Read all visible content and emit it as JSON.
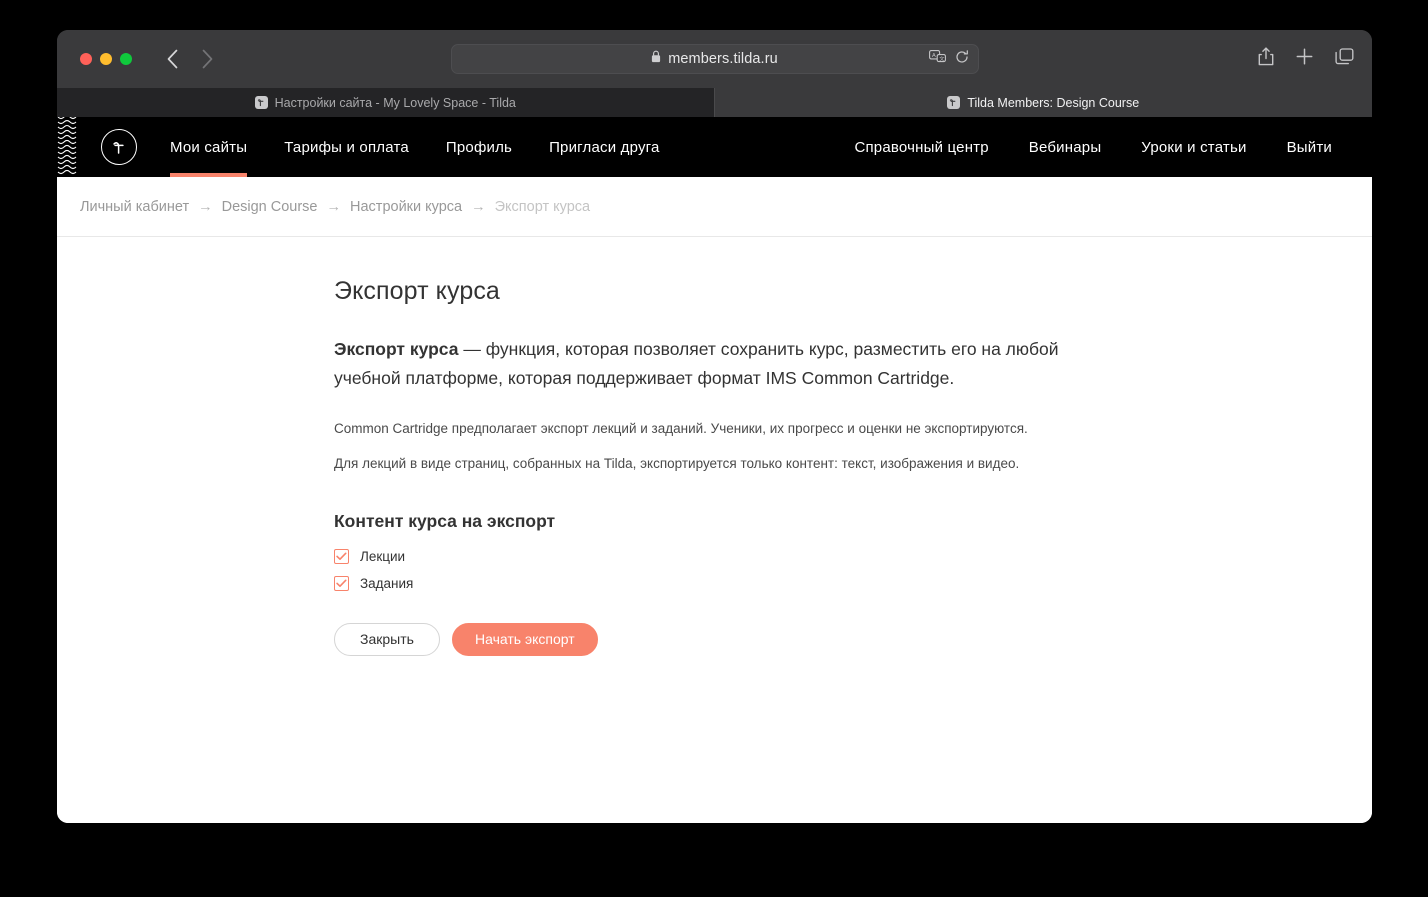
{
  "browser": {
    "url": "members.tilda.ru",
    "lock_icon": "lock-icon",
    "back_icon": "back-arrow-icon",
    "forward_icon": "forward-arrow-icon",
    "translate_icon": "translate-icon",
    "reload_icon": "reload-icon",
    "share_icon": "share-icon",
    "newtab_icon": "plus-icon",
    "taboverview_icon": "tab-overview-icon",
    "traffic": {
      "close": "close-window-button",
      "minimize": "minimize-window-button",
      "zoom": "zoom-window-button"
    },
    "tabs": [
      {
        "title": "Настройки сайта - My Lovely Space - Tilda",
        "active": false,
        "favicon": "tilda-favicon"
      },
      {
        "title": "Tilda Members: Design Course",
        "active": true,
        "favicon": "tilda-favicon"
      }
    ]
  },
  "site_nav": {
    "logo_alt": "tilda-logo",
    "left_links": [
      {
        "label": "Мои сайты",
        "active": true
      },
      {
        "label": "Тарифы и оплата",
        "active": false
      },
      {
        "label": "Профиль",
        "active": false
      },
      {
        "label": "Пригласи друга",
        "active": false
      }
    ],
    "right_links": [
      {
        "label": "Справочный центр"
      },
      {
        "label": "Вебинары"
      },
      {
        "label": "Уроки и статьи"
      },
      {
        "label": "Выйти"
      }
    ]
  },
  "breadcrumb": {
    "separator": "→",
    "items": [
      {
        "label": "Личный кабинет",
        "current": false
      },
      {
        "label": "Design Course",
        "current": false
      },
      {
        "label": "Настройки курса",
        "current": false
      },
      {
        "label": "Экспорт курса",
        "current": true
      }
    ]
  },
  "main": {
    "title": "Экспорт курса",
    "lead_bold": "Экспорт курса",
    "lead_rest": " — функция, которая позволяет сохранить курс, разместить его на любой учебной платформе, которая поддерживает формат IMS Common Cartridge.",
    "note_1": "Common Cartridge предполагает экспорт лекций и заданий. Ученики, их прогресс и оценки не экспортируются.",
    "note_2": "Для лекций в виде страниц, собранных на Tilda, экспортируется только контент: текст, изображения и видео.",
    "section_title": "Контент курса на экспорт",
    "checkboxes": [
      {
        "label": "Лекции",
        "checked": true
      },
      {
        "label": "Задания",
        "checked": true
      }
    ],
    "buttons": {
      "close": "Закрыть",
      "start_export": "Начать экспорт"
    }
  },
  "colors": {
    "accent": "#f8836b",
    "nav_bg": "#000000",
    "chrome_bg": "#3a3a3c",
    "page_bg": "#ffffff",
    "text": "#333333",
    "muted": "#999999"
  }
}
